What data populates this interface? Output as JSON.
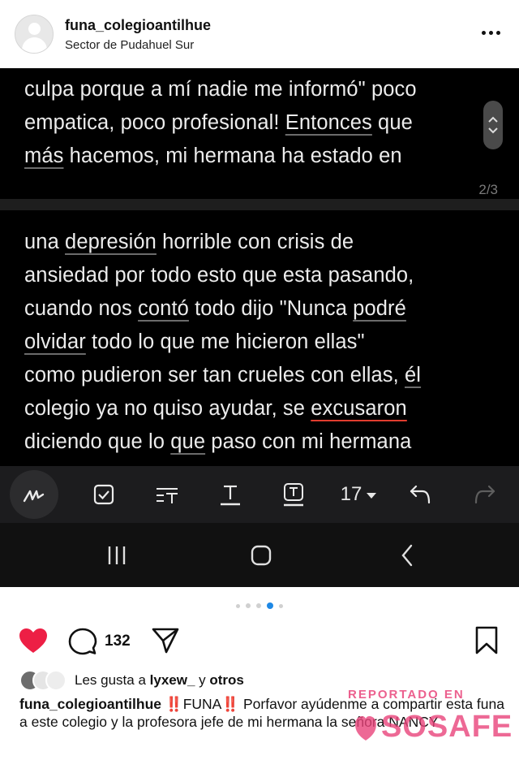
{
  "header": {
    "username": "funa_colegioantilhue",
    "location": "Sector de Pudahuel Sur"
  },
  "screenshot": {
    "note_top_lines": [
      "culpa porque a mí nadie me informó\" poco",
      "empatica, poco profesional! Entonces que",
      "más hacemos, mi hermana ha estado en"
    ],
    "page_counter": "2/3",
    "note_mid_lines": [
      "una depresión horrible con crisis de",
      "ansiedad por todo esto que esta pasando,",
      "cuando nos contó todo dijo \"Nunca podré",
      "olvidar todo lo que me hicieron ellas\"",
      "como pudieron ser tan crueles con ellas, él",
      "colegio ya no quiso ayudar, se excusaron",
      "diciendo que lo que paso con mi hermana"
    ],
    "font_size_value": "17",
    "accent_color": "#e03c2e"
  },
  "carousel": {
    "dot_count": 5,
    "active_index": 3
  },
  "actions": {
    "comment_count": "132"
  },
  "likes": {
    "prefix": "Les gusta a",
    "user": "lyxew_",
    "connector": "y",
    "others": "otros"
  },
  "caption": {
    "username": "funa_colegioantilhue",
    "bang1": "‼️",
    "funa_word": "FUNA",
    "bang2": "‼️",
    "text": " Porfavor ayúdenme a compartir esta funa a este colegio y la profesora jefe de mi hermana la señora NANCY"
  },
  "watermark": {
    "tagline": "REPORTADO EN",
    "brand": "SOSAFE",
    "color": "#e9447a"
  }
}
